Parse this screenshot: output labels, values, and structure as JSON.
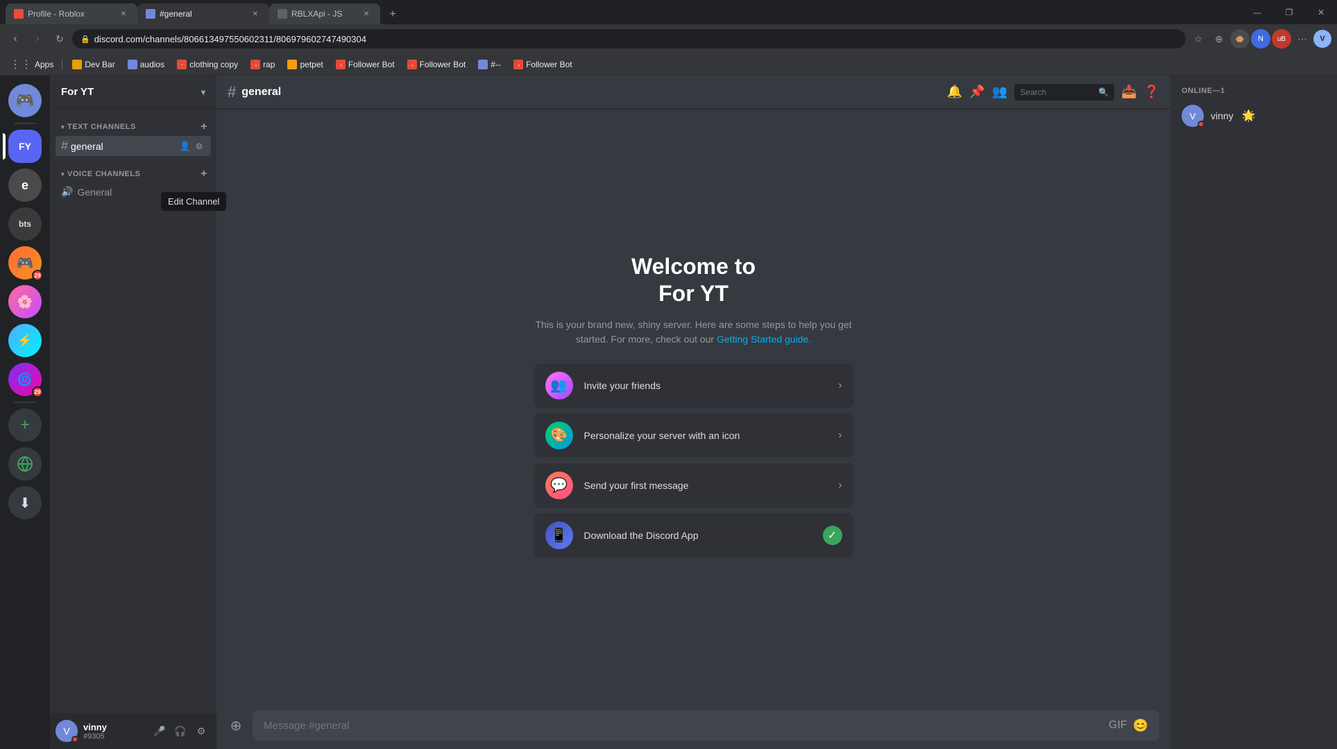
{
  "browser": {
    "tabs": [
      {
        "id": "tab1",
        "favicon_color": "#e74c3c",
        "label": "Profile - Roblox",
        "active": false
      },
      {
        "id": "tab2",
        "favicon_color": "#7289da",
        "label": "#general",
        "active": true
      },
      {
        "id": "tab3",
        "favicon_color": "#36393f",
        "label": "RBLXApi - JS",
        "active": false
      }
    ],
    "new_tab_label": "+",
    "url": "discord.com/channels/806613497550602311/806979602747490304",
    "window_controls": [
      "—",
      "❐",
      "✕"
    ]
  },
  "bookmarks": [
    {
      "id": "apps",
      "label": "Apps",
      "has_icon": true
    },
    {
      "id": "dev-bar",
      "label": "Dev Bar"
    },
    {
      "id": "audios",
      "label": "audios"
    },
    {
      "id": "clothing-copy",
      "label": "clothing copy"
    },
    {
      "id": "rap",
      "label": "rap"
    },
    {
      "id": "petpet",
      "label": "petpet"
    },
    {
      "id": "follower-bot-1",
      "label": "Follower Bot"
    },
    {
      "id": "follower-bot-2",
      "label": "Follower Bot"
    },
    {
      "id": "hash-icon",
      "label": "#--"
    },
    {
      "id": "follower-bot-3",
      "label": "Follower Bot"
    }
  ],
  "server": {
    "name": "For YT",
    "channel": "general"
  },
  "channels": {
    "text_category": "Text Channels",
    "voice_category": "Voice Channels",
    "text_channels": [
      {
        "name": "general",
        "active": true
      }
    ],
    "voice_channels": [
      {
        "name": "General"
      }
    ]
  },
  "welcome": {
    "title_line1": "Welcome to",
    "title_line2": "For YT",
    "description": "This is your brand new, shiny server. Here are some steps to help you get started. For more, check out our",
    "guide_link": "Getting Started guide.",
    "actions": [
      {
        "id": "invite",
        "label": "Invite your friends",
        "icon": "👥",
        "gradient": "invite",
        "completed": false
      },
      {
        "id": "personalize",
        "label": "Personalize your server with an icon",
        "icon": "🎨",
        "gradient": "personalize",
        "completed": false
      },
      {
        "id": "message",
        "label": "Send your first message",
        "icon": "💬",
        "gradient": "message",
        "completed": false
      },
      {
        "id": "download",
        "label": "Download the Discord App",
        "icon": "📱",
        "gradient": "download",
        "completed": true
      }
    ]
  },
  "message_input": {
    "placeholder": "Message #general"
  },
  "members": {
    "online_label": "ONLINE—1",
    "list": [
      {
        "name": "vinny",
        "badge": "🌟",
        "avatar_bg": "#7289da",
        "status": "dnd"
      }
    ]
  },
  "user": {
    "name": "vinny",
    "tag": "#9305",
    "avatar_bg": "#7289da",
    "status": "dnd"
  },
  "edit_channel_tooltip": "Edit Channel",
  "header_search_placeholder": "Search"
}
